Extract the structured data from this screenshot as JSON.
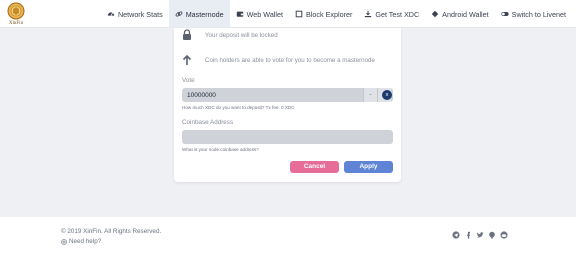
{
  "brand": {
    "logo_text": "XinFin"
  },
  "nav": {
    "items": [
      {
        "label": "Network Stats",
        "icon": "dashboard-icon"
      },
      {
        "label": "Masternode",
        "icon": "link-icon",
        "active": true
      },
      {
        "label": "Web Wallet",
        "icon": "wallet-icon"
      },
      {
        "label": "Block Explorer",
        "icon": "cube-icon"
      },
      {
        "label": "Get Test XDC",
        "icon": "download-icon"
      },
      {
        "label": "Android Wallet",
        "icon": "android-icon"
      },
      {
        "label": "Switch to Livenet",
        "icon": "toggle-icon"
      }
    ]
  },
  "info": {
    "locked_text": "Your deposit will be locked",
    "vote_text": "Coin holders are able to vote for you to become a masternode"
  },
  "vote": {
    "label": "Vote",
    "value": "10000000",
    "decrement": "-",
    "increment": "+",
    "clear": "x",
    "help": "How much XDC do you want to deposit? Tx fee: 0 XDC"
  },
  "coinbase": {
    "label": "Coinbase Address",
    "value": "",
    "help": "What is your node coinbase address?"
  },
  "actions": {
    "cancel": "Cancel",
    "apply": "Apply"
  },
  "footer": {
    "copyright": "© 2019 XinFin. All Rights Reserved.",
    "help": "Need help?",
    "social": [
      "telegram-icon",
      "facebook-icon",
      "twitter-icon",
      "github-icon",
      "reddit-icon"
    ]
  },
  "colors": {
    "cancel": "#e56d97",
    "apply": "#5f84d6",
    "clear": "#1e3a6e",
    "active_nav": "#e8edf3"
  }
}
